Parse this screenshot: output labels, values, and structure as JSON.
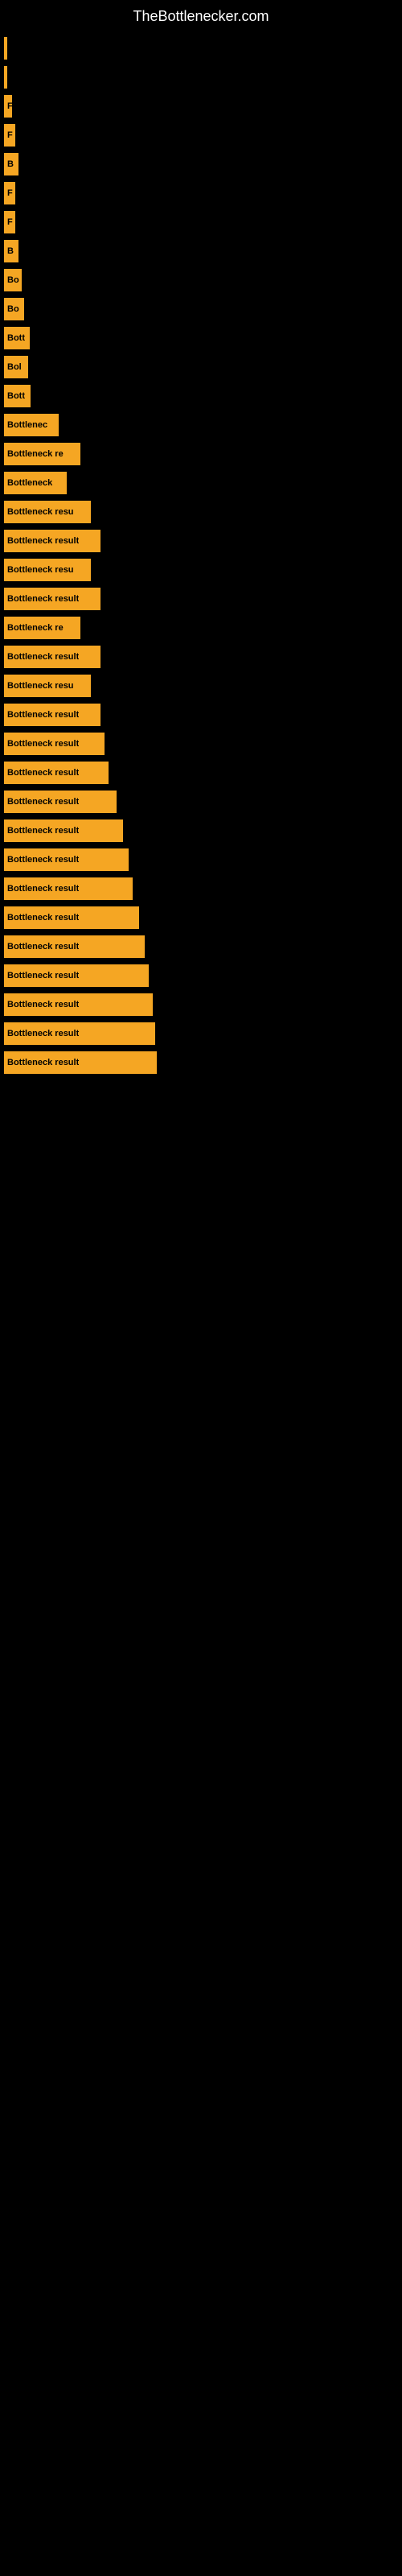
{
  "site": {
    "title": "TheBottlenecker.com"
  },
  "bars": [
    {
      "label": "",
      "width": 2
    },
    {
      "label": "",
      "width": 4
    },
    {
      "label": "F",
      "width": 10
    },
    {
      "label": "F",
      "width": 14
    },
    {
      "label": "B",
      "width": 18
    },
    {
      "label": "F",
      "width": 14
    },
    {
      "label": "F",
      "width": 14
    },
    {
      "label": "B",
      "width": 18
    },
    {
      "label": "Bo",
      "width": 22
    },
    {
      "label": "Bo",
      "width": 25
    },
    {
      "label": "Bott",
      "width": 32
    },
    {
      "label": "Bol",
      "width": 30
    },
    {
      "label": "Bott",
      "width": 33
    },
    {
      "label": "Bottlenec",
      "width": 68
    },
    {
      "label": "Bottleneck re",
      "width": 95
    },
    {
      "label": "Bottleneck",
      "width": 78
    },
    {
      "label": "Bottleneck resu",
      "width": 108
    },
    {
      "label": "Bottleneck result",
      "width": 120
    },
    {
      "label": "Bottleneck resu",
      "width": 108
    },
    {
      "label": "Bottleneck result",
      "width": 120
    },
    {
      "label": "Bottleneck re",
      "width": 95
    },
    {
      "label": "Bottleneck result",
      "width": 120
    },
    {
      "label": "Bottleneck resu",
      "width": 108
    },
    {
      "label": "Bottleneck result",
      "width": 120
    },
    {
      "label": "Bottleneck result",
      "width": 125
    },
    {
      "label": "Bottleneck result",
      "width": 130
    },
    {
      "label": "Bottleneck result",
      "width": 140
    },
    {
      "label": "Bottleneck result",
      "width": 148
    },
    {
      "label": "Bottleneck result",
      "width": 155
    },
    {
      "label": "Bottleneck result",
      "width": 160
    },
    {
      "label": "Bottleneck result",
      "width": 168
    },
    {
      "label": "Bottleneck result",
      "width": 175
    },
    {
      "label": "Bottleneck result",
      "width": 180
    },
    {
      "label": "Bottleneck result",
      "width": 185
    },
    {
      "label": "Bottleneck result",
      "width": 188
    },
    {
      "label": "Bottleneck result",
      "width": 190
    }
  ]
}
